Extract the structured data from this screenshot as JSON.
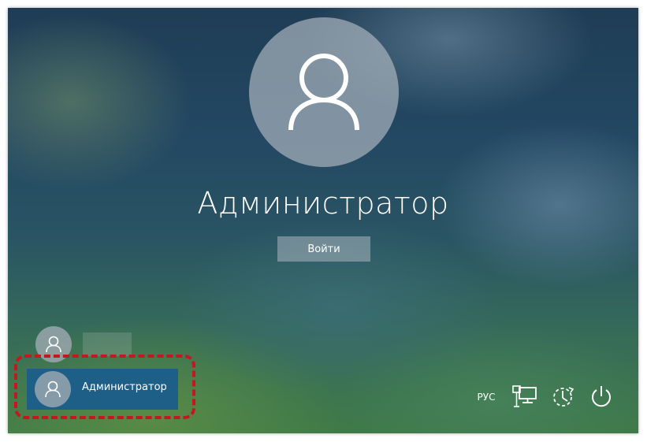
{
  "login": {
    "username": "Администратор",
    "signin_label": "Войти"
  },
  "user_list": {
    "selected_user_label": "Администратор"
  },
  "tray": {
    "language": "РУС"
  },
  "colors": {
    "selected_row": "#1e5f88",
    "highlight_border": "#c4171f"
  },
  "icons": [
    "user-icon",
    "network-icon",
    "ease-of-access-icon",
    "power-icon"
  ]
}
